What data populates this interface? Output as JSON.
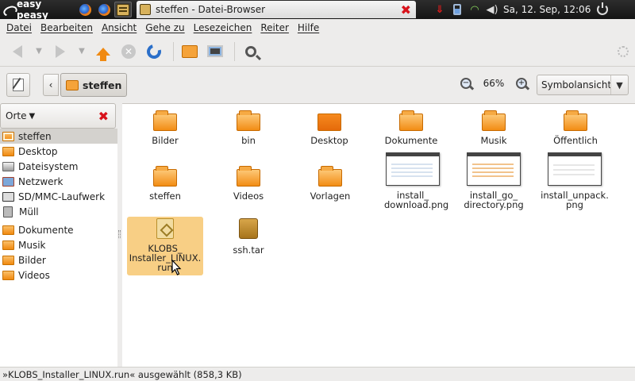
{
  "panel": {
    "brand": "easy peasy",
    "window_title": "steffen - Datei-Browser",
    "clock": "Sa, 12. Sep, 12:06"
  },
  "menu": [
    "Datei",
    "Bearbeiten",
    "Ansicht",
    "Gehe zu",
    "Lesezeichen",
    "Reiter",
    "Hilfe"
  ],
  "location": {
    "current": "steffen",
    "zoom": "66%",
    "view_mode": "Symbolansicht"
  },
  "sidebar": {
    "header": "Orte",
    "places": [
      {
        "label": "steffen",
        "icon": "home-folder-icon"
      },
      {
        "label": "Desktop",
        "icon": "folder-icon"
      },
      {
        "label": "Dateisystem",
        "icon": "drive-icon"
      },
      {
        "label": "Netzwerk",
        "icon": "network-icon"
      },
      {
        "label": "SD/MMC-Laufwerk",
        "icon": "sd-card-icon"
      },
      {
        "label": "Müll",
        "icon": "trash-icon"
      }
    ],
    "bookmarks": [
      {
        "label": "Dokumente",
        "icon": "folder-icon"
      },
      {
        "label": "Musik",
        "icon": "folder-icon"
      },
      {
        "label": "Bilder",
        "icon": "folder-icon"
      },
      {
        "label": "Videos",
        "icon": "folder-icon"
      }
    ]
  },
  "files": [
    {
      "name": "Bilder",
      "type": "folder"
    },
    {
      "name": "bin",
      "type": "folder"
    },
    {
      "name": "Desktop",
      "type": "desktop-folder"
    },
    {
      "name": "Dokumente",
      "type": "folder"
    },
    {
      "name": "Musik",
      "type": "folder"
    },
    {
      "name": "Öffentlich",
      "type": "folder"
    },
    {
      "name": "steffen",
      "type": "folder"
    },
    {
      "name": "Videos",
      "type": "folder"
    },
    {
      "name": "Vorlagen",
      "type": "folder"
    },
    {
      "name": "install_ download.png",
      "type": "image"
    },
    {
      "name": "install_go_ directory.png",
      "type": "image"
    },
    {
      "name": "install_unpack. png",
      "type": "image"
    },
    {
      "name": "KLOBS_ Installer_LINUX. run",
      "type": "executable",
      "selected": true
    },
    {
      "name": "ssh.tar",
      "type": "archive"
    }
  ],
  "status": "»KLOBS_Installer_LINUX.run« ausgewählt (858,3 KB)",
  "colors": {
    "accent_folder": "#f28c14",
    "selection": "#f8cf85",
    "panel_bg": "#1e1e1e",
    "close_red": "#d8121b"
  }
}
